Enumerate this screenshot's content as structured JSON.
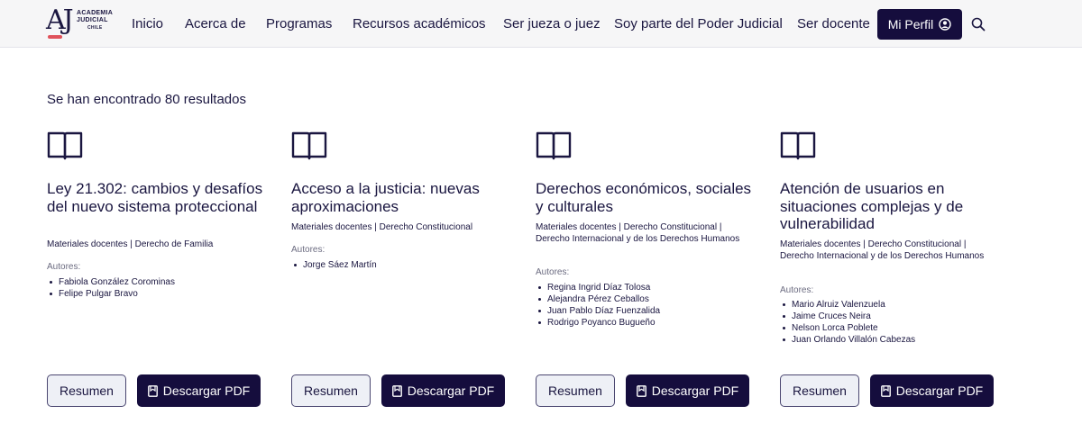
{
  "logo": {
    "initials": "AJ",
    "line1": "ACADEMIA",
    "line2": "JUDICIAL",
    "line3": "CHILE"
  },
  "nav": {
    "items": [
      "Inicio",
      "Acerca de",
      "Programas",
      "Recursos académicos",
      "Ser jueza o juez",
      "Soy parte del Poder Judicial",
      "Ser docente"
    ],
    "profile_label": "Mi Perfil"
  },
  "colors": {
    "brand": "#150d3d",
    "accent": "#e0525b"
  },
  "results_text": "Se han encontrado 80 resultados",
  "authors_label": "Autores:",
  "buttons": {
    "summary": "Resumen",
    "download": "Descargar PDF"
  },
  "cards": [
    {
      "title": "Ley 21.302: cambios y desafíos del nuevo sistema proteccional",
      "categories": "Materiales docentes | Derecho de Familia",
      "authors": [
        "Fabiola González Corominas",
        "Felipe Pulgar Bravo"
      ]
    },
    {
      "title": "Acceso a la justicia: nuevas aproximaciones",
      "categories": "Materiales docentes | Derecho Constitucional",
      "authors": [
        "Jorge Sáez Martín"
      ]
    },
    {
      "title": "Derechos económicos, sociales y culturales",
      "categories": "Materiales docentes | Derecho Constitucional | Derecho Internacional y de los Derechos Humanos",
      "authors": [
        "Regina Ingrid Díaz Tolosa",
        "Alejandra Pérez Ceballos",
        "Juan Pablo Díaz Fuenzalida",
        "Rodrigo Poyanco Bugueño"
      ]
    },
    {
      "title": "Atención de usuarios en situaciones complejas y de vulnerabilidad",
      "categories": "Materiales docentes | Derecho Constitucional | Derecho Internacional y de los Derechos Humanos",
      "authors": [
        "Mario Alruiz Valenzuela",
        "Jaime Cruces Neira",
        "Nelson Lorca Poblete",
        "Juan Orlando Villalón Cabezas"
      ]
    }
  ]
}
